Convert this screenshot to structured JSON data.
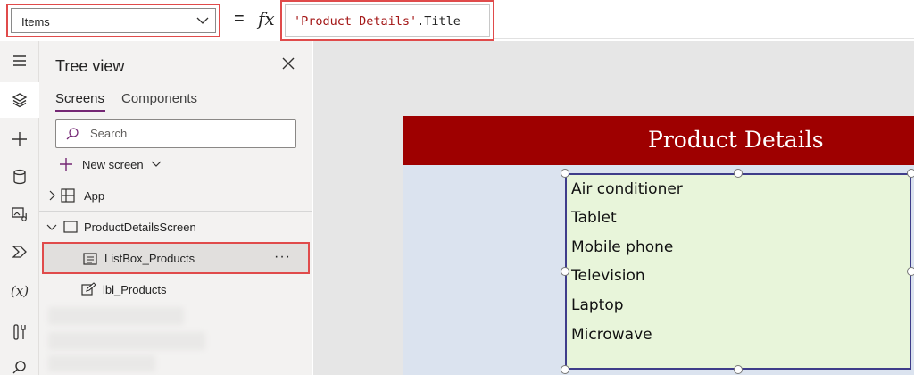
{
  "formula_bar": {
    "property": "Items",
    "equals": "=",
    "fx_icon": "fx",
    "formula_string": "'Product Details'",
    "formula_property": ".Title"
  },
  "left_rail": {
    "icons": [
      "hamburger-icon",
      "layers-icon",
      "plus-icon",
      "data-icon",
      "media-icon",
      "power-automate-icon",
      "variables-icon",
      "tools-icon",
      "search-icon"
    ],
    "variables_glyph": "(x)"
  },
  "tree_view": {
    "title": "Tree view",
    "tabs": [
      {
        "label": "Screens",
        "active": true
      },
      {
        "label": "Components",
        "active": false
      }
    ],
    "search_placeholder": "Search",
    "new_screen_label": "New screen",
    "items": [
      {
        "label": "App",
        "icon": "app-grid-icon"
      },
      {
        "label": "ProductDetailsScreen",
        "icon": "screen-icon"
      },
      {
        "label": "ListBox_Products",
        "icon": "listbox-icon",
        "selected": true,
        "more": "···"
      },
      {
        "label": "lbl_Products",
        "icon": "edit-label-icon"
      }
    ]
  },
  "canvas": {
    "header_title": "Product Details",
    "header_color": "#9e0000",
    "listbox_items": [
      "Air conditioner",
      "Tablet",
      "Mobile phone",
      "Television",
      "Laptop",
      "Microwave"
    ]
  },
  "colors": {
    "highlight": "#e04b4b",
    "accent": "#742774",
    "listbox_bg": "#e8f5da",
    "screen_bg": "#dbe3ef"
  }
}
